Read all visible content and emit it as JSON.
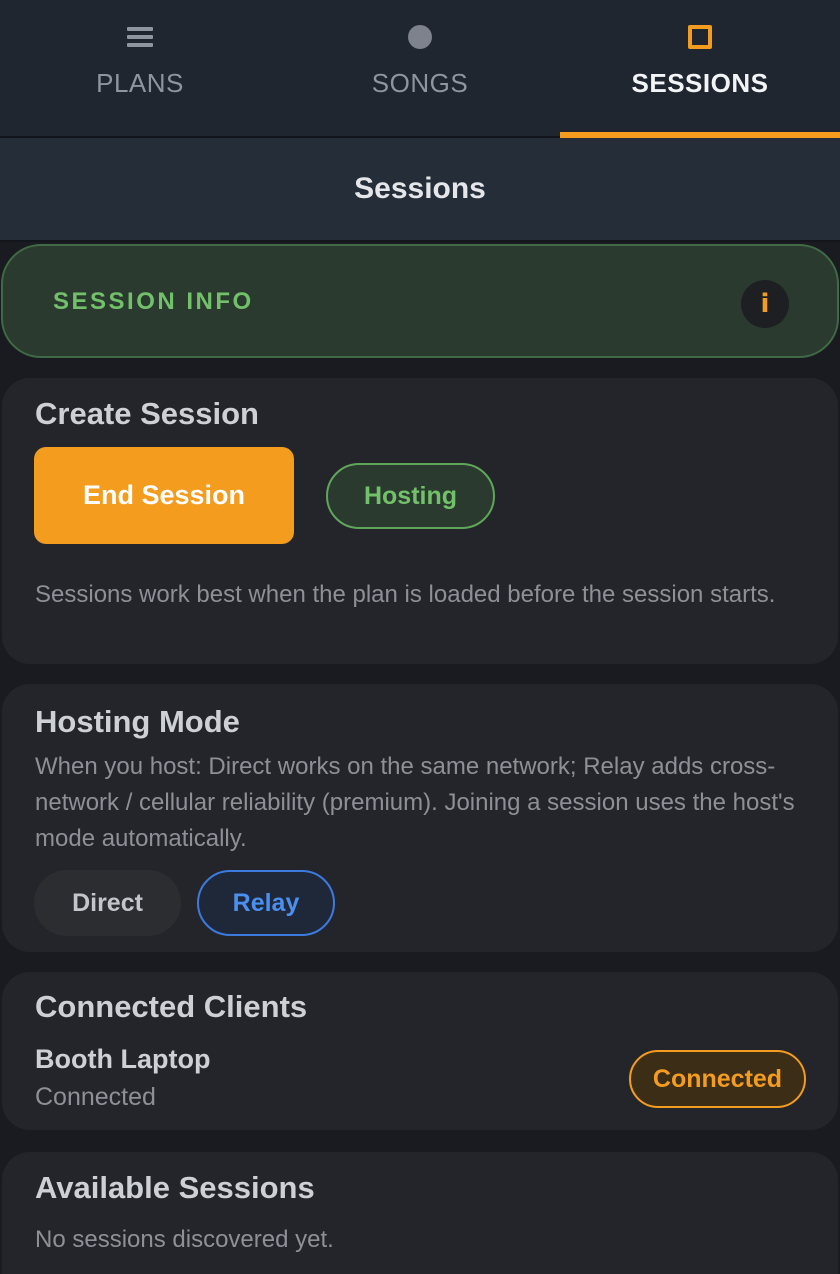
{
  "tabs": [
    {
      "label": "PLANS",
      "icon": "menu-icon",
      "active": false
    },
    {
      "label": "SONGS",
      "icon": "circle-icon",
      "active": false
    },
    {
      "label": "SESSIONS",
      "icon": "square-icon",
      "active": true
    }
  ],
  "header": {
    "title": "Sessions"
  },
  "session_info": {
    "title": "SESSION INFO",
    "info_icon": "i"
  },
  "create_session": {
    "title": "Create Session",
    "end_button": "End Session",
    "status_pill": "Hosting",
    "hint": "Sessions work best when the plan is loaded before the session starts."
  },
  "hosting_mode": {
    "title": "Hosting Mode",
    "description": "When you host: Direct works on the same network; Relay adds cross-network / cellular reliability (premium). Joining a session uses the host's mode automatically.",
    "options": [
      "Direct",
      "Relay"
    ],
    "selected": "Relay"
  },
  "connected_clients": {
    "title": "Connected Clients",
    "clients": [
      {
        "name": "Booth Laptop",
        "status": "Connected",
        "badge": "Connected"
      }
    ]
  },
  "available_sessions": {
    "title": "Available Sessions",
    "empty_text": "No sessions discovered yet."
  },
  "colors": {
    "accent": "#f39c1e",
    "success": "#72c16a",
    "relay_blue": "#4b8ff0",
    "background": "#1a1b20"
  }
}
